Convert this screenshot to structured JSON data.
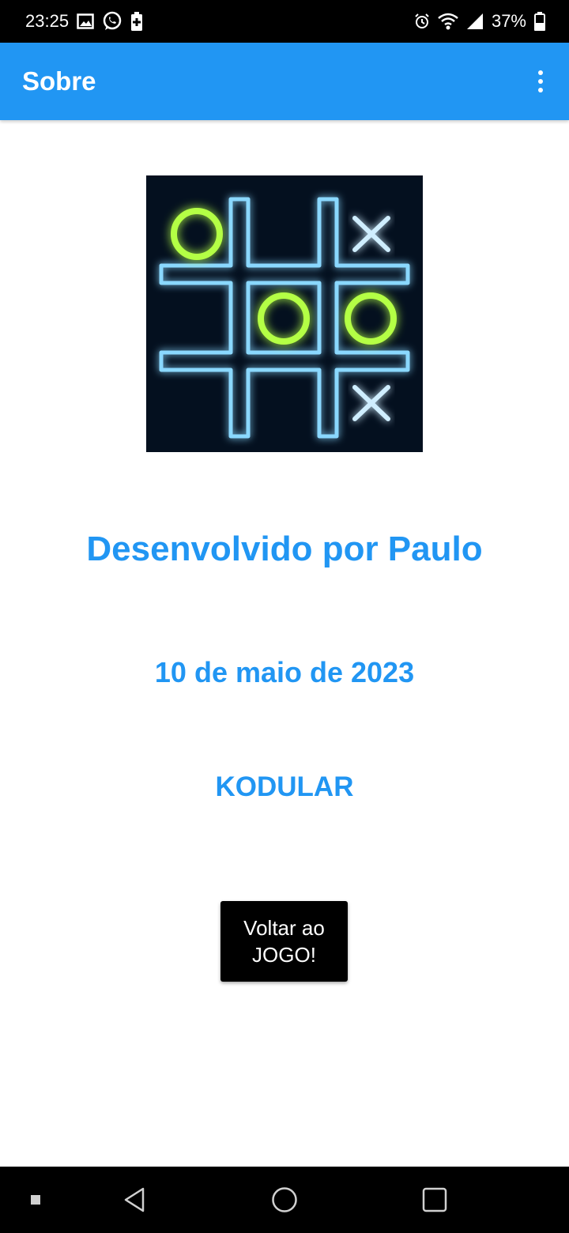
{
  "status_bar": {
    "time": "23:25",
    "battery_percent": "37%",
    "left_icons": [
      "image-icon",
      "whatsapp-icon",
      "battery-saver-icon"
    ],
    "right_icons": [
      "alarm-icon",
      "wifi-icon",
      "signal-icon",
      "battery-icon"
    ]
  },
  "app_bar": {
    "title": "Sobre",
    "menu_icon": "more-vert-icon"
  },
  "content": {
    "logo_icon": "tic-tac-toe-neon-logo",
    "developer_text": "Desenvolvido por Paulo",
    "date_text": "10 de maio de 2023",
    "platform_text": "KODULAR",
    "back_button_label": "Voltar ao JOGO!"
  },
  "nav_bar": {
    "icons": [
      "menu-square-icon",
      "back-icon",
      "home-icon",
      "recents-icon"
    ]
  },
  "colors": {
    "accent": "#2196f3",
    "status_bar": "#000000",
    "button": "#000000",
    "logo_grid": "#38b8ff",
    "logo_o": "#9dff2e"
  }
}
